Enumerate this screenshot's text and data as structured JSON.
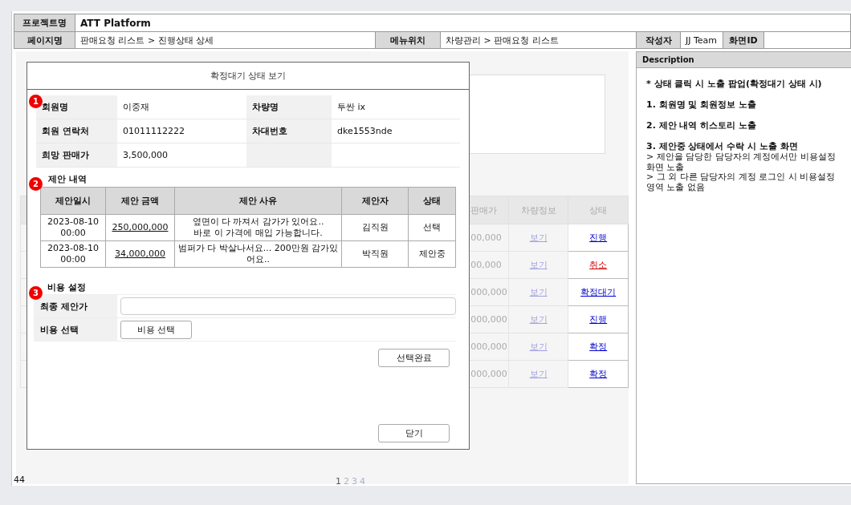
{
  "header": {
    "project_label": "프로젝트명",
    "project": "ATT Platform",
    "page_label": "페이지명",
    "page": "판매요청 리스트 > 진행상태 상세",
    "menu_label": "메뉴위치",
    "menu": "차량관리 > 판매요청 리스트",
    "author_label": "작성자",
    "author": "JJ Team",
    "screen_id_label": "화면ID"
  },
  "list": {
    "columns": [
      "판매가",
      "차량정보",
      "상태"
    ],
    "rows": [
      {
        "price": "00,000",
        "info": "보기",
        "status": "진행",
        "color": "#0000cc"
      },
      {
        "price": "00,000",
        "info": "보기",
        "status": "취소",
        "color": "#cc0000"
      },
      {
        "price": "000,000",
        "info": "보기",
        "status": "확정대기",
        "color": "#0000cc"
      },
      {
        "price": "000,000",
        "info": "보기",
        "status": "진행",
        "color": "#0000cc"
      },
      {
        "price": "000,000",
        "info": "보기",
        "status": "확정",
        "color": "#0000cc"
      },
      {
        "price": "000,000",
        "info": "보기",
        "status": "확정",
        "color": "#0000cc"
      }
    ]
  },
  "pagination": [
    {
      "label": "1",
      "selected": true
    },
    {
      "label": "2",
      "selected": false
    },
    {
      "label": "3",
      "selected": false
    },
    {
      "label": "4",
      "selected": false
    }
  ],
  "page_number": "44",
  "modal": {
    "title": "확정대기 상태 보기",
    "member_badge": "1",
    "member_rows": [
      {
        "label": "회원명",
        "value": "이중재",
        "label2": "차량명",
        "value2": "투싼 ix"
      },
      {
        "label": "회원 연락처",
        "value": "01011112222",
        "label2": "차대번호",
        "value2": "dke1553nde"
      },
      {
        "label": "희망 판매가",
        "value": "3,500,000"
      }
    ],
    "proposal_badge": "2",
    "proposal_title": "제안 내역",
    "proposal_columns": [
      "제안일시",
      "제안 금액",
      "제안 사유",
      "제안자",
      "상태"
    ],
    "proposals": [
      {
        "date": "2023-08-10",
        "time": "00:00",
        "amount": "250,000,000",
        "reason": [
          "옆면이 다 까져서 감가가 있어요..",
          "바로 이 가격에 매입 가능합니다."
        ],
        "proposer": "김직원",
        "status": "선택"
      },
      {
        "date": "2023-08-10",
        "time": "00:00",
        "amount": "34,000,000",
        "reason": [
          "범퍼가 다 박살나서요... 200만원 감가있어요.."
        ],
        "proposer": "박직원",
        "status": "제안중"
      }
    ],
    "cost_badge": "3",
    "cost_title": "비용 설정",
    "final_label": "최종 제안가",
    "select_label": "비용 선택",
    "select_button": "비용 선택",
    "done_button": "선택완료",
    "close_button": "닫기"
  },
  "description": {
    "title": "Description",
    "lines": [
      {
        "kind": "item",
        "text": "* 상태 클릭 시 노출 팝업(확정대기 상태 시)"
      },
      {
        "kind": "item",
        "text": "1. 회원명 및 회원정보 노출"
      },
      {
        "kind": "item",
        "text": "2. 제안 내역 히스토리 노출"
      },
      {
        "kind": "item",
        "text": "3. 제안중 상태에서 수락 시 노출 화면"
      },
      {
        "kind": "note",
        "text": "> 제안을 담당한 담당자의 계정에서만 비용설정 화면 노출"
      },
      {
        "kind": "note",
        "text": "> 그 외 다른 담당자의 계정 로그인 시 비용설정 영역 노출 없음"
      }
    ]
  }
}
